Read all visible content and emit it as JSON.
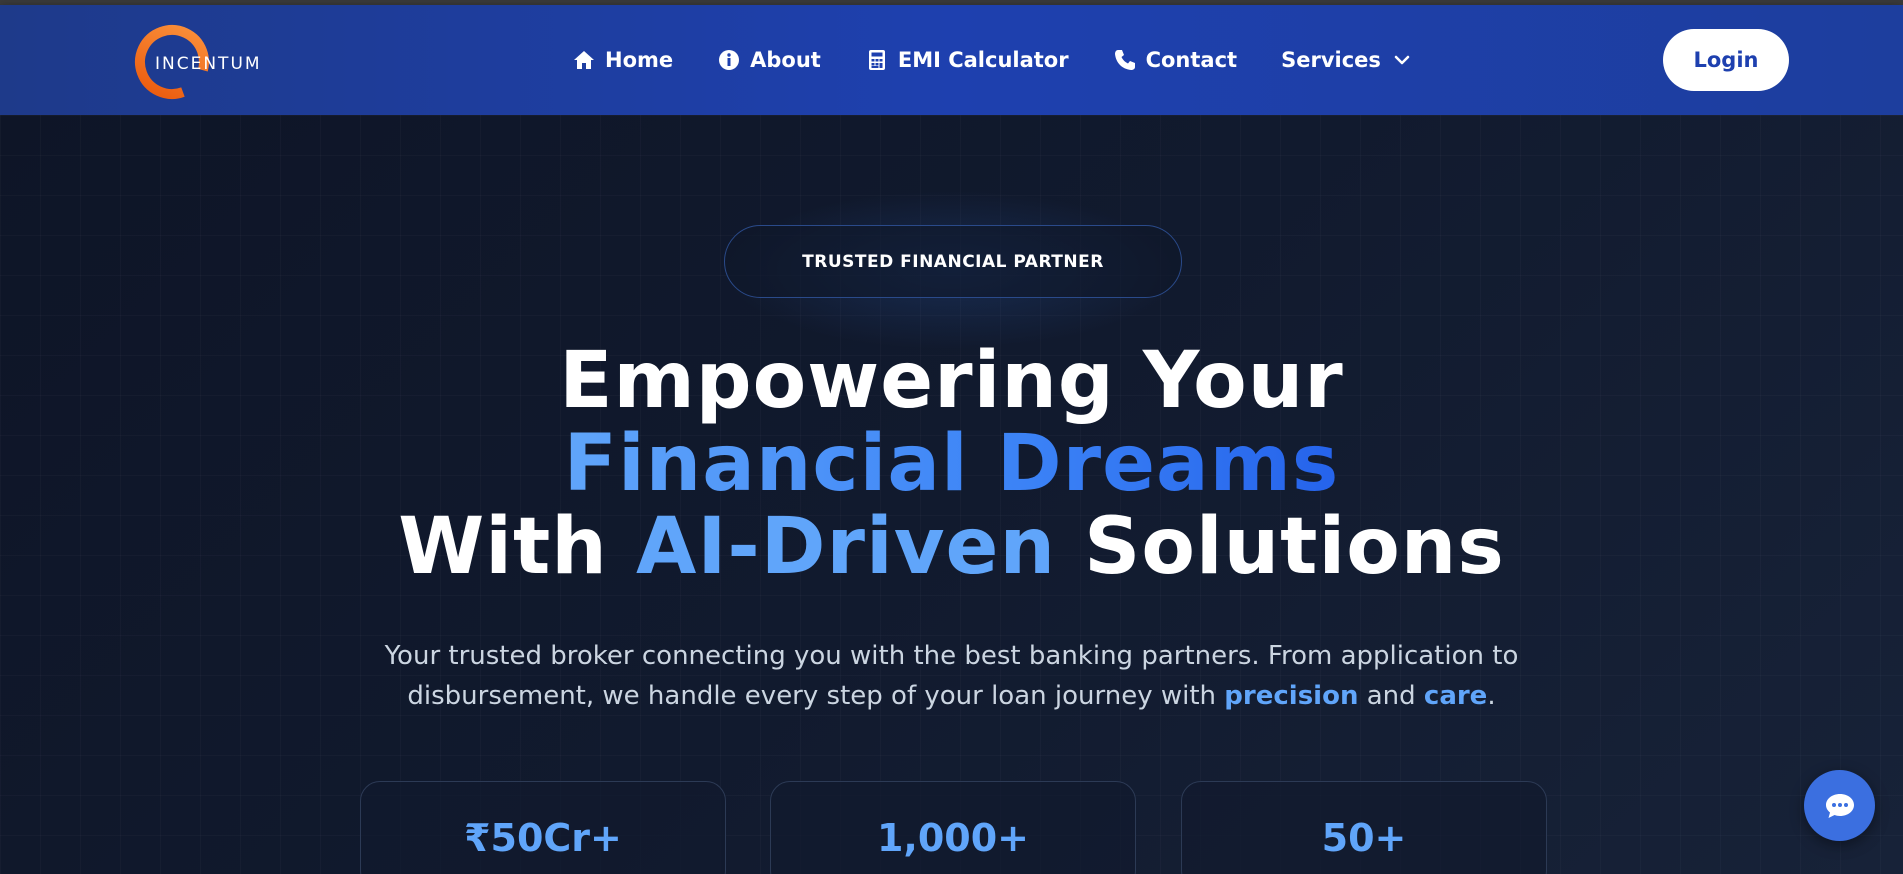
{
  "header": {
    "logo_text": "INCENTUM",
    "nav": [
      {
        "label": "Home",
        "icon": "home-icon"
      },
      {
        "label": "About",
        "icon": "info-icon"
      },
      {
        "label": "EMI Calculator",
        "icon": "calculator-icon"
      },
      {
        "label": "Contact",
        "icon": "phone-icon"
      },
      {
        "label": "Services",
        "icon": "chevron-down-icon"
      }
    ],
    "login_label": "Login"
  },
  "hero": {
    "badge": "TRUSTED FINANCIAL PARTNER",
    "headline": {
      "line1": "Empowering Your",
      "line2": "Financial Dreams",
      "line3_a": "With ",
      "line3_b": "AI-Driven",
      "line3_c": " Solutions"
    },
    "subtext": {
      "part1": "Your trusted broker connecting you with the best banking partners. From application to disbursement, we handle every step of your loan journey with ",
      "em1": "precision",
      "part2": " and ",
      "em2": "care",
      "part3": "."
    },
    "stats": [
      {
        "value": "₹50Cr+"
      },
      {
        "value": "1,000+"
      },
      {
        "value": "50+"
      }
    ]
  },
  "colors": {
    "nav_bg": "#1e40af",
    "accent": "#60a5fa",
    "logo_orange": "#f97316",
    "hero_bg": "#0f172a"
  },
  "chat": {
    "icon": "chat-bubble-icon"
  }
}
